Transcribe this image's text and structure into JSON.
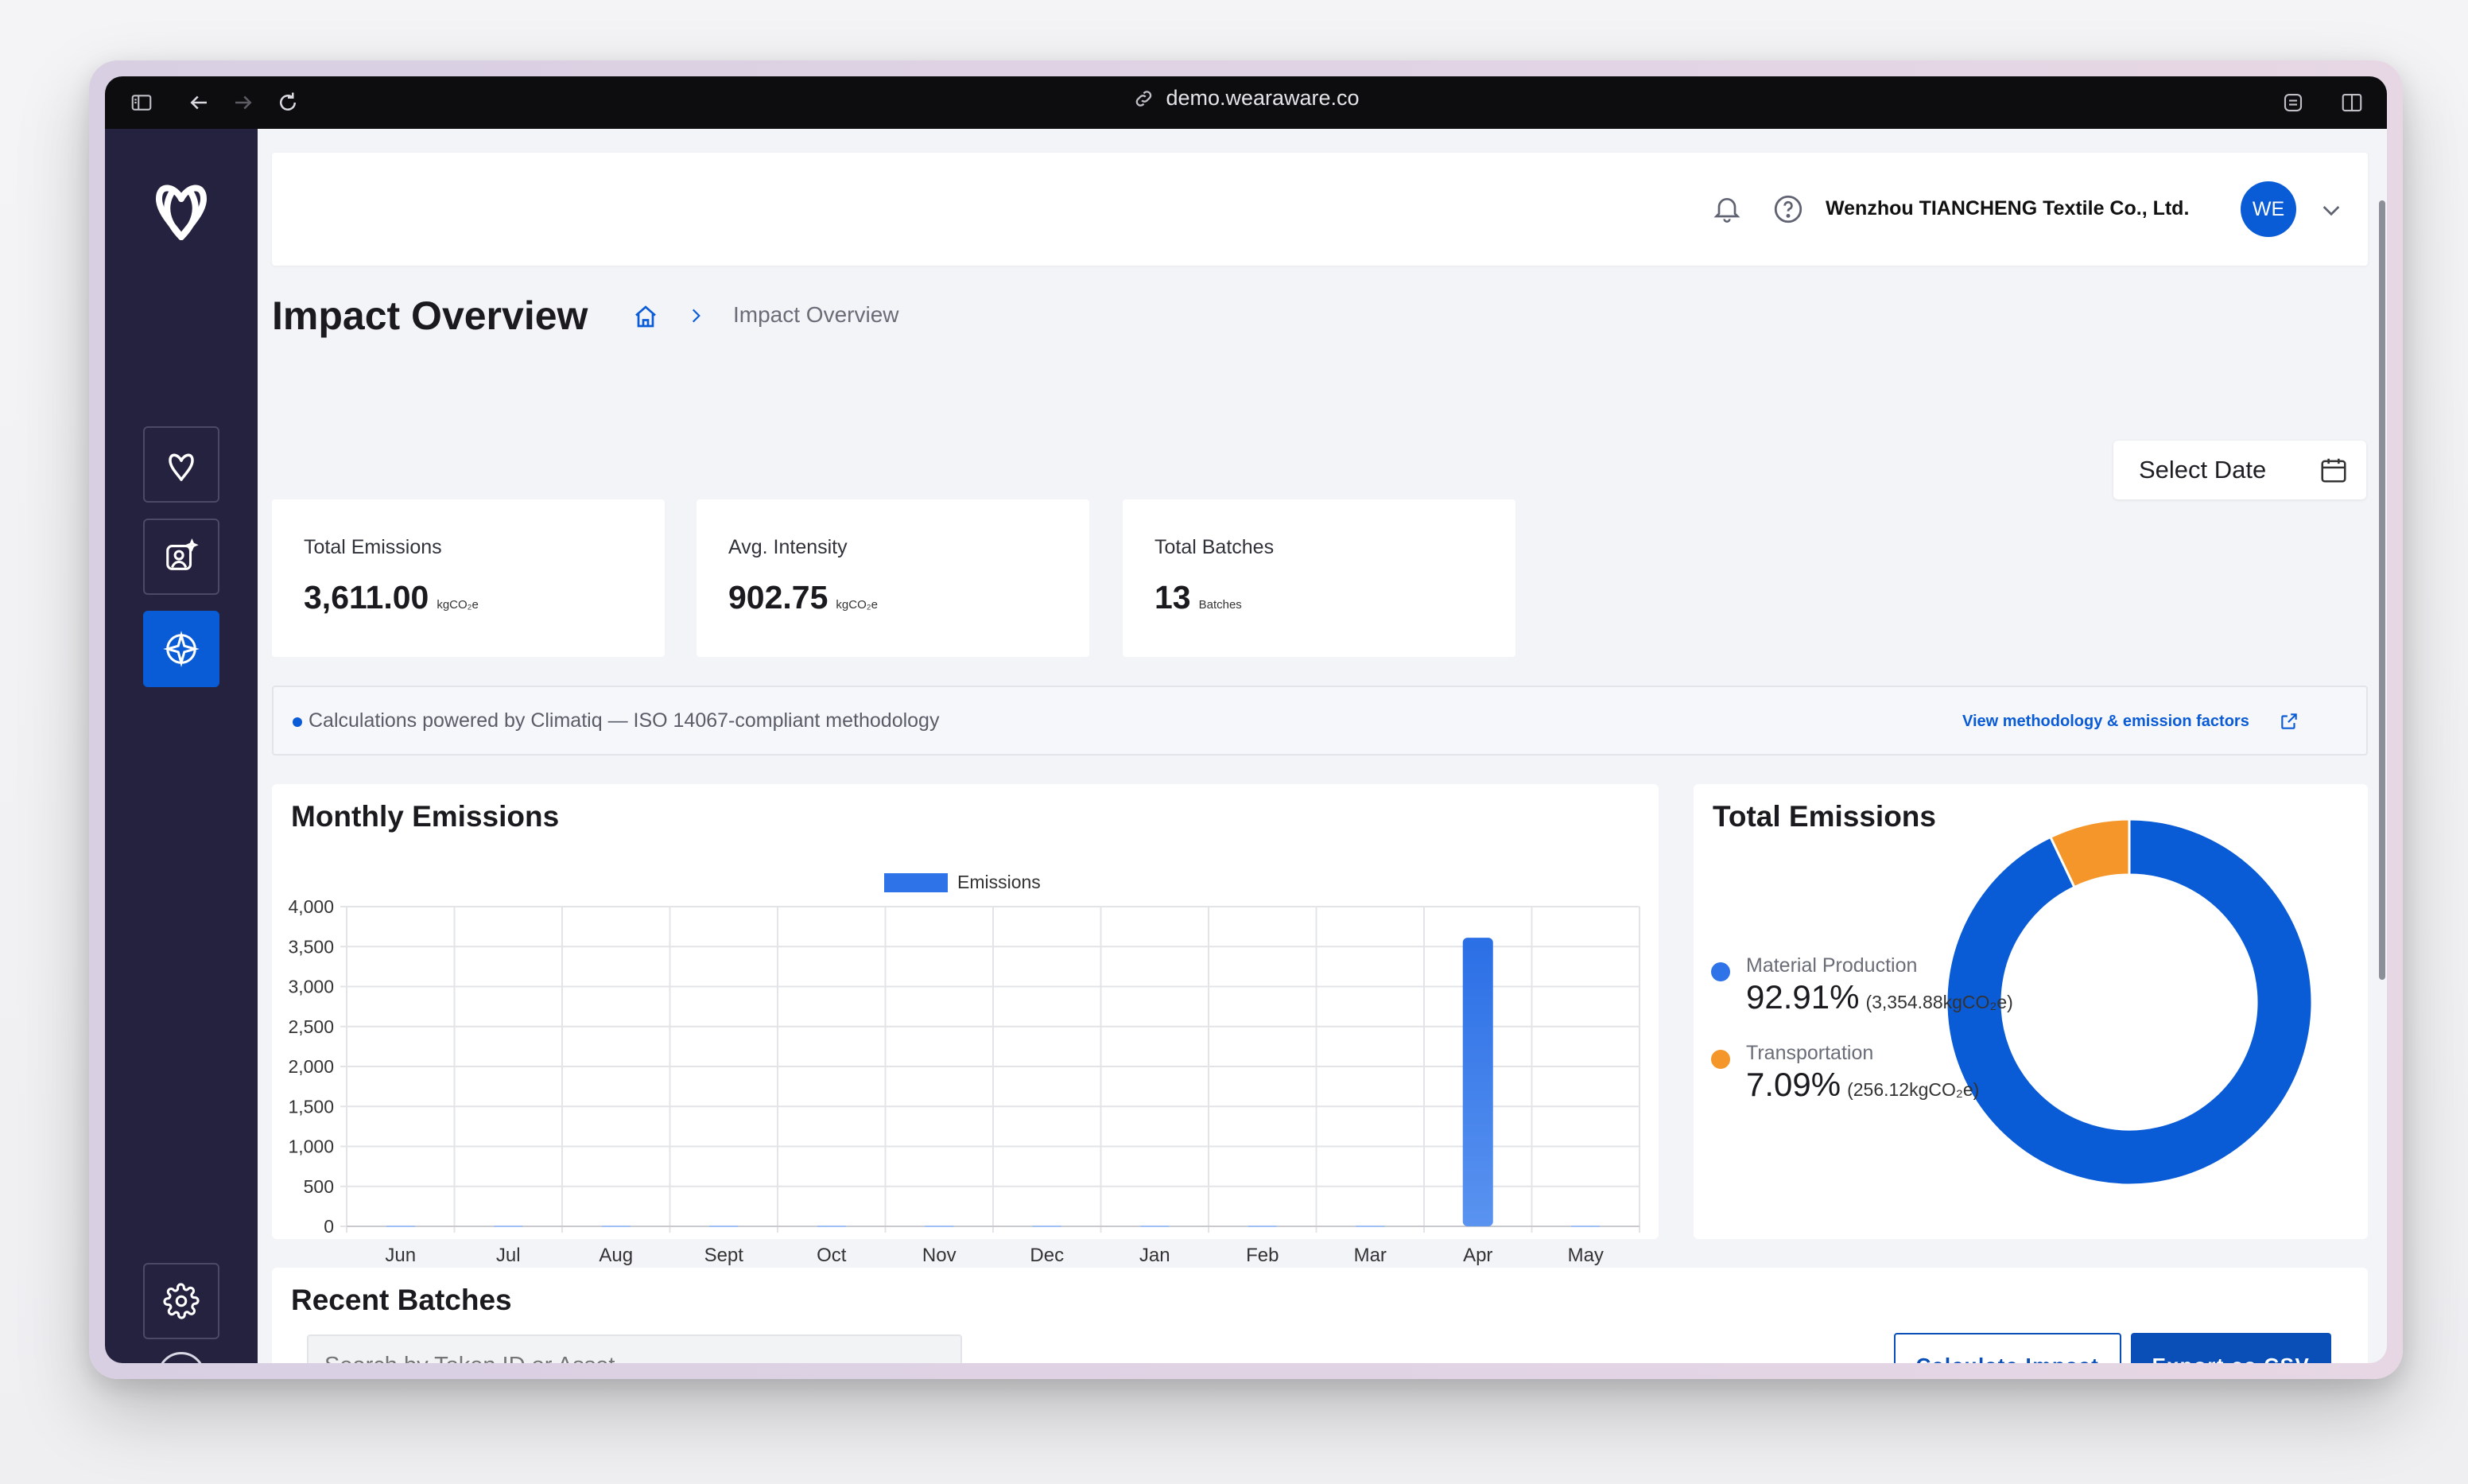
{
  "browser": {
    "url": "demo.wearaware.co"
  },
  "header": {
    "company_name": "Wenzhou TIANCHENG Textile Co., Ltd.",
    "avatar_initials": "WE"
  },
  "page": {
    "title": "Impact Overview",
    "breadcrumb_current": "Impact Overview",
    "select_date_label": "Select Date"
  },
  "stats": [
    {
      "label": "Total Emissions",
      "value": "3,611.00",
      "unit": "kgCO₂e"
    },
    {
      "label": "Avg. Intensity",
      "value": "902.75",
      "unit": "kgCO₂e"
    },
    {
      "label": "Total Batches",
      "value": "13",
      "unit": "Batches"
    }
  ],
  "info_bar": {
    "text": "Calculations powered by Climatiq — ISO 14067-compliant methodology",
    "link": "View methodology & emission factors"
  },
  "monthly": {
    "title": "Monthly Emissions",
    "legend": "Emissions",
    "y_ticks": [
      "4,000",
      "3,500",
      "3,000",
      "2,500",
      "2,000",
      "1,500",
      "1,000",
      "500",
      "0"
    ]
  },
  "donut": {
    "title": "Total Emissions",
    "items": [
      {
        "name": "Material Production",
        "percent": "92.91%",
        "detail": "(3,354.88kgCO₂e)"
      },
      {
        "name": "Transportation",
        "percent": "7.09%",
        "detail": "(256.12kgCO₂e)"
      }
    ]
  },
  "recent": {
    "title": "Recent Batches",
    "search_placeholder": "Search by Token ID or Asset",
    "calculate_label": "Calculate Impact",
    "export_label": "Export as CSV"
  },
  "colors": {
    "primary": "#0a5bd6",
    "sidebar": "#24223f",
    "bar": "#2f73e8",
    "orange": "#f5962a"
  },
  "icons": {
    "sidebar_logo": "aware-logo-icon",
    "nav": [
      "aware-logo-icon",
      "user-sparkle-icon",
      "compass-icon"
    ],
    "settings": "gear-icon",
    "expand": "arrow-right-icon"
  },
  "chart_data": {
    "type": "bar",
    "title": "Monthly Emissions",
    "xlabel": "",
    "ylabel": "",
    "categories": [
      "Jun",
      "Jul",
      "Aug",
      "Sept",
      "Oct",
      "Nov",
      "Dec",
      "Jan",
      "Feb",
      "Mar",
      "Apr",
      "May"
    ],
    "series": [
      {
        "name": "Emissions",
        "values": [
          0,
          0,
          0,
          0,
          0,
          0,
          0,
          0,
          0,
          0,
          3611,
          0
        ]
      }
    ],
    "ylim": [
      0,
      4000
    ],
    "grid": true,
    "legend": "top-center",
    "pie": {
      "type": "pie",
      "title": "Total Emissions",
      "categories": [
        "Material Production",
        "Transportation"
      ],
      "values": [
        92.91,
        7.09
      ]
    }
  }
}
